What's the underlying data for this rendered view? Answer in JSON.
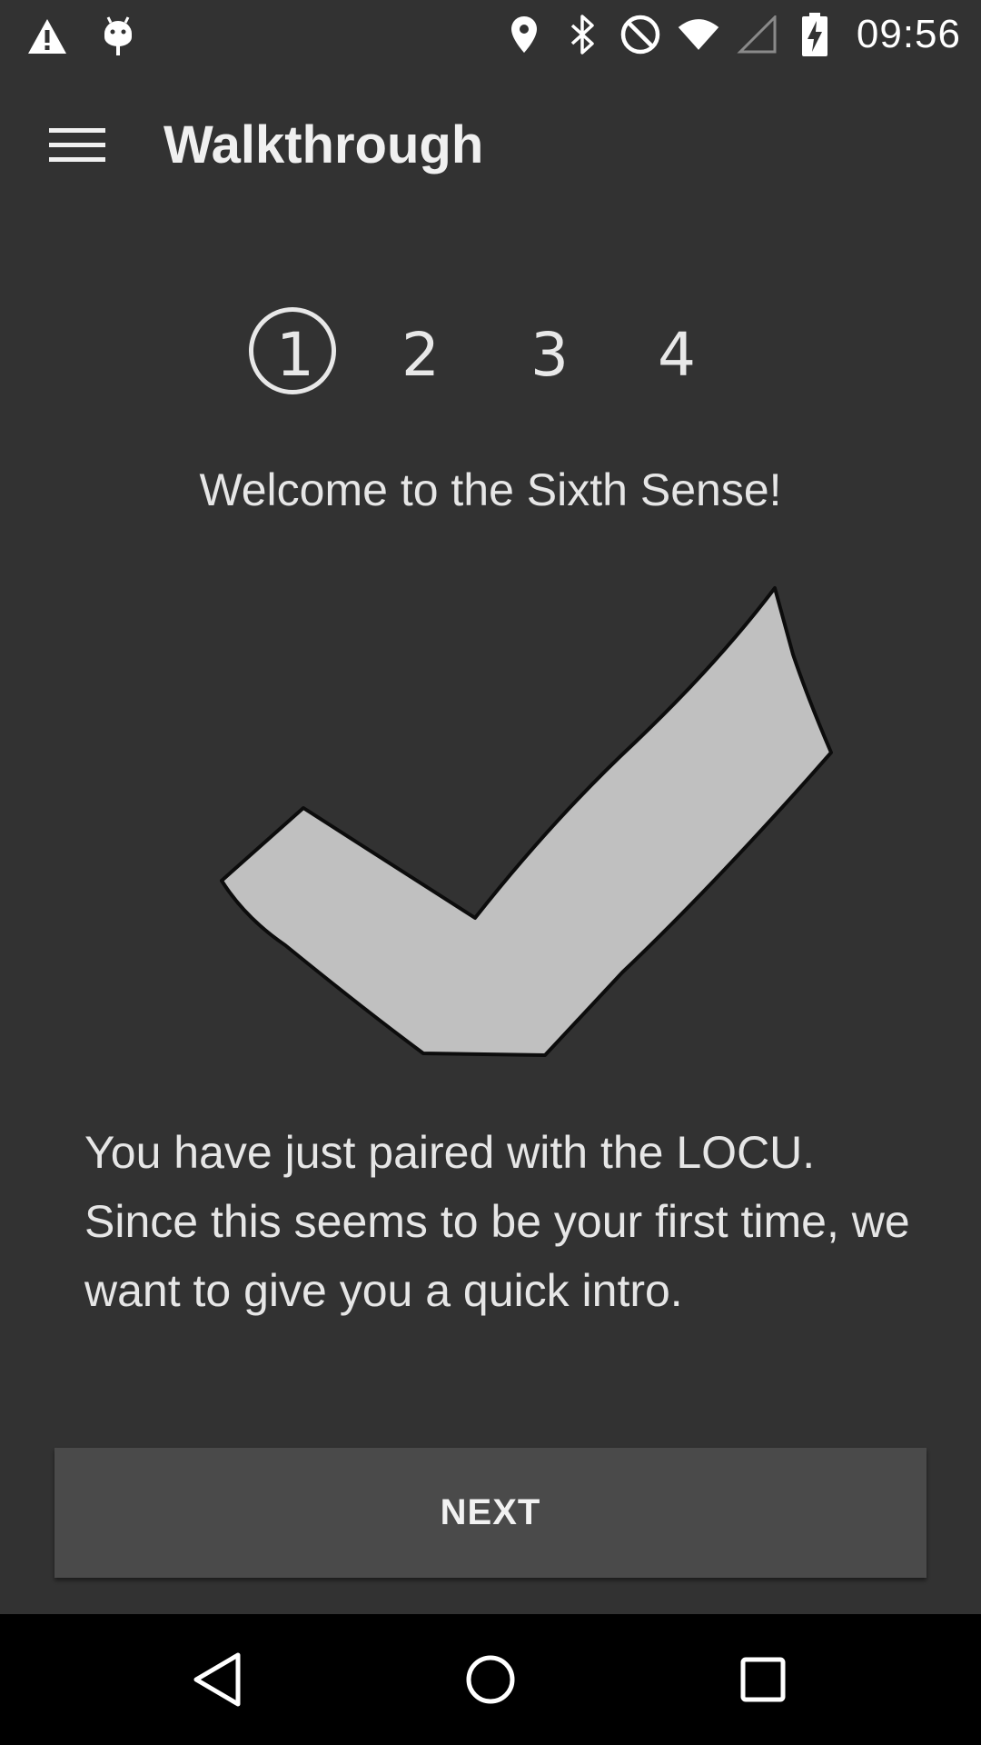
{
  "status_bar": {
    "time": "09:56",
    "left_icons": [
      "warning-icon",
      "android-debug-icon"
    ],
    "right_icons": [
      "location-icon",
      "bluetooth-icon",
      "do-not-disturb-icon",
      "wifi-icon",
      "cellular-signal-icon",
      "battery-charging-icon"
    ]
  },
  "app_bar": {
    "title": "Walkthrough",
    "menu_icon": "hamburger-menu-icon"
  },
  "steps": {
    "items": [
      "1",
      "2",
      "3",
      "4"
    ],
    "current": 1
  },
  "main": {
    "welcome": "Welcome to the Sixth Sense!",
    "illustration_icon": "checkmark-icon",
    "intro": "You have just paired with the LOCU. Since this seems to be your first time, we want to give you a quick intro."
  },
  "next_button": {
    "label": "NEXT"
  },
  "nav_bar": {
    "back": "back-icon",
    "home": "home-icon",
    "recents": "recents-icon"
  },
  "colors": {
    "background": "#323232",
    "button": "#4a4a4a",
    "nav_bar": "#000000",
    "check_fill": "#c0c0c0"
  }
}
